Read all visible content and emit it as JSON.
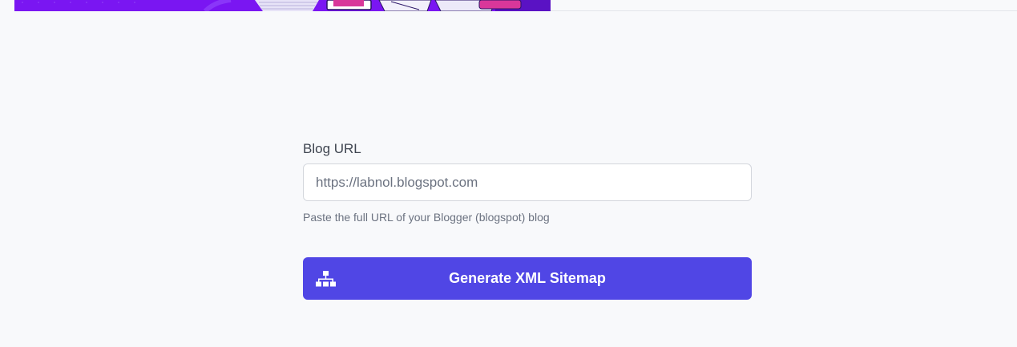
{
  "form": {
    "label": "Blog URL",
    "input_placeholder": "https://labnol.blogspot.com",
    "input_value": "",
    "help_text": "Paste the full URL of your Blogger (blogspot) blog"
  },
  "generate_button": {
    "label": "Generate XML Sitemap",
    "icon": "sitemap-icon"
  },
  "colors": {
    "button": "#5046e5",
    "banner": "#7a16f2",
    "background": "#f8f9fb"
  }
}
